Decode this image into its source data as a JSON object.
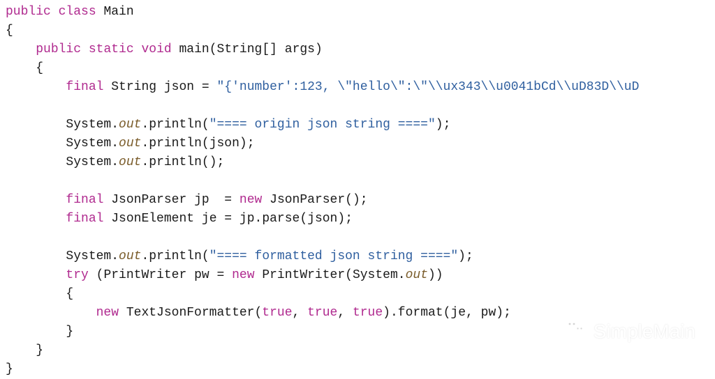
{
  "code": {
    "line01": {
      "kw_public": "public",
      "kw_class": "class",
      "cls_main": "Main"
    },
    "line02": {
      "brace": "{"
    },
    "line03": {
      "kw_public": "public",
      "kw_static": "static",
      "kw_void": "void",
      "m_main": "main",
      "lp": "(",
      "t_string": "String",
      "brk": "[]",
      "args": "args",
      "rp": ")"
    },
    "line04": {
      "brace": "{"
    },
    "line05": {
      "kw_final": "final",
      "t_string": "String",
      "v_json": "json",
      "eq": " = ",
      "str": "\"{'number':123, \\\"hello\\\":\\\"\\\\ux343\\\\u0041bCd\\\\uD83D\\\\uD"
    },
    "line07": {
      "sys": "System",
      "dot": ".",
      "out": "out",
      "p": "println",
      "lp": "(",
      "str": "\"==== origin json string ====\"",
      "rp": ")",
      "sc": ";"
    },
    "line08": {
      "sys": "System",
      "dot": ".",
      "out": "out",
      "p": "println",
      "lp": "(",
      "arg": "json",
      "rp": ")",
      "sc": ";"
    },
    "line09": {
      "sys": "System",
      "dot": ".",
      "out": "out",
      "p": "println",
      "lp": "(",
      "rp": ")",
      "sc": ";"
    },
    "line11": {
      "kw_final": "final",
      "t_jp": "JsonParser",
      "v_jp": "jp",
      "eq": "  = ",
      "kw_new": "new",
      "ctor": "JsonParser",
      "lp": "(",
      "rp": ")",
      "sc": ";"
    },
    "line12": {
      "kw_final": "final",
      "t_je": "JsonElement",
      "v_je": "je",
      "eq": " = ",
      "obj": "jp",
      "dot": ".",
      "m": "parse",
      "lp": "(",
      "arg": "json",
      "rp": ")",
      "sc": ";"
    },
    "line14": {
      "sys": "System",
      "dot": ".",
      "out": "out",
      "p": "println",
      "lp": "(",
      "str": "\"==== formatted json string ====\"",
      "rp": ")",
      "sc": ";"
    },
    "line15": {
      "kw_try": "try",
      "lp": " (",
      "t_pw": "PrintWriter",
      "v_pw": "pw",
      "eq": " = ",
      "kw_new": "new",
      "ctor": "PrintWriter",
      "lp2": "(",
      "sys": "System",
      "dot": ".",
      "out": "out",
      "rp2": ")",
      "rp": ")"
    },
    "line16": {
      "brace": "{"
    },
    "line17": {
      "kw_new": "new",
      "ctor": "TextJsonFormatter",
      "lp": "(",
      "a1": "true",
      "c": ", ",
      "a2": "true",
      "c2": ", ",
      "a3": "true",
      "rp": ")",
      "dot": ".",
      "m": "format",
      "lp2": "(",
      "arg1": "je",
      "c3": ", ",
      "arg2": "pw",
      "rp2": ")",
      "sc": ";"
    },
    "line18": {
      "brace": "}"
    },
    "line19": {
      "brace": "}"
    },
    "line20": {
      "brace": "}"
    }
  },
  "watermark": {
    "text": "SimpleMain"
  }
}
